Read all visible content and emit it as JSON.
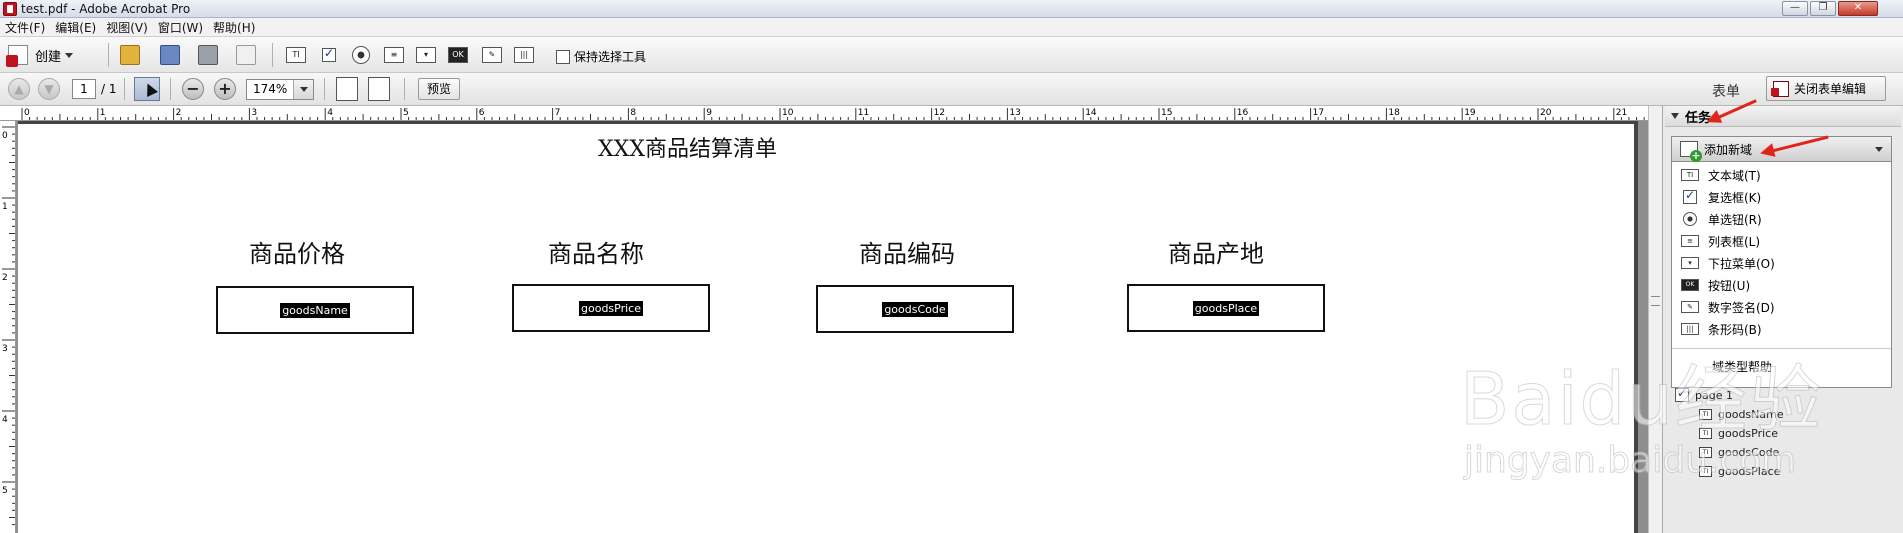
{
  "window": {
    "title": "test.pdf - Adobe Acrobat Pro",
    "controls": [
      "—",
      "❐",
      "✕"
    ]
  },
  "menu": [
    "文件(F)",
    "编辑(E)",
    "视图(V)",
    "窗口(W)",
    "帮助(H)"
  ],
  "toolbar": {
    "create_label": "创建",
    "keep_tool_label": "保持选择工具",
    "field_icons": [
      "TI",
      "OK"
    ]
  },
  "navigation": {
    "page_current": "1",
    "page_total": "/ 1",
    "zoom": "174%",
    "preview_label": "预览",
    "form_label": "表单",
    "close_form_label": "关闭表单编辑"
  },
  "document": {
    "title": "XXX商品结算清单",
    "columns": [
      {
        "label": "商品价格",
        "field": "goodsName"
      },
      {
        "label": "商品名称",
        "field": "goodsPrice"
      },
      {
        "label": "商品编码",
        "field": "goodsCode"
      },
      {
        "label": "商品产地",
        "field": "goodsPlace"
      }
    ],
    "ruler_h": [
      "0",
      "1",
      "2",
      "3",
      "4",
      "5",
      "6",
      "7",
      "8",
      "9",
      "10",
      "11",
      "12",
      "13",
      "14",
      "15",
      "16",
      "17",
      "18",
      "19",
      "20",
      "21"
    ],
    "ruler_v": [
      "0",
      "1",
      "2",
      "3",
      "4",
      "5"
    ]
  },
  "task_panel": {
    "header": "任务",
    "add_field_label": "添加新域",
    "items": [
      "文本域(T)",
      "复选框(K)",
      "单选钮(R)",
      "列表框(L)",
      "下拉菜单(O)",
      "按钮(U)",
      "数字签名(D)",
      "条形码(B)"
    ],
    "help_label": "域类型帮助",
    "tree": [
      "page 1",
      "goodsName",
      "goodsPrice",
      "goodsCode",
      "goodsPlace"
    ]
  },
  "watermark": {
    "main": "Baidu经验",
    "sub": "jingyan.baidu.com"
  },
  "colors": {
    "accent_red": "#e0261c",
    "doc_bg": "#8e8e8e"
  }
}
